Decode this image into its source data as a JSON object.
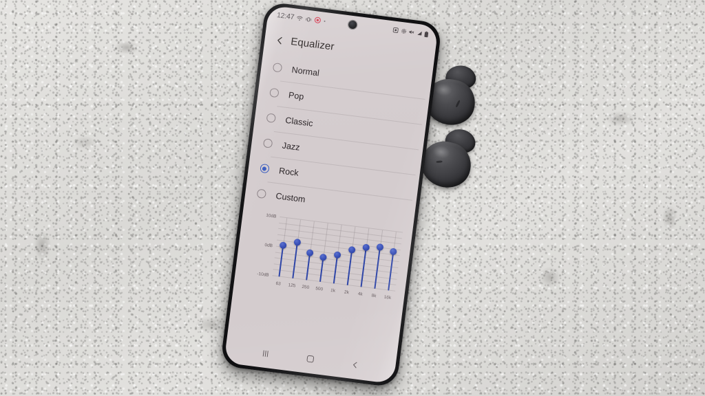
{
  "scene": {
    "background": "textured white concrete wall",
    "device": "smartphone lying on wall, rotated slightly clockwise",
    "accessory": "two dark grey wireless earbuds"
  },
  "statusbar": {
    "clock": "12:47",
    "left_icons": [
      "wifi-icon",
      "vibrate-icon",
      "record-icon",
      "dot-icon"
    ],
    "right_icons": [
      "screenshot-icon",
      "settings-icon",
      "mute-icon",
      "signal-icon",
      "battery-icon"
    ]
  },
  "appbar": {
    "back_label": "back-chevron",
    "title": "Equalizer"
  },
  "presets": {
    "selected": "Rock",
    "items": [
      {
        "label": "Normal",
        "selected": false
      },
      {
        "label": "Pop",
        "selected": false
      },
      {
        "label": "Classic",
        "selected": false
      },
      {
        "label": "Jazz",
        "selected": false
      },
      {
        "label": "Rock",
        "selected": true
      },
      {
        "label": "Custom",
        "selected": false
      }
    ]
  },
  "chart_data": {
    "type": "bar",
    "title": "Equalizer",
    "xlabel": "",
    "ylabel": "dB",
    "categories": [
      "63",
      "125",
      "250",
      "500",
      "1k",
      "2k",
      "4k",
      "8k",
      "16k"
    ],
    "values": [
      0.6,
      2.4,
      -0.8,
      -1.6,
      -0.2,
      2.2,
      3.6,
      4.2,
      3.2
    ],
    "ylim": [
      -10,
      10
    ],
    "ytick_labels": [
      "10dB",
      "0dB",
      "-10dB"
    ],
    "yticks": [
      10,
      0,
      -10
    ],
    "grid": true,
    "legend": "none",
    "accent_color": "#3c5ec0"
  },
  "navbar": {
    "recents_label": "recents-button",
    "home_label": "home-button",
    "back_label": "back-button"
  },
  "colors": {
    "accent": "#3c5ec0",
    "screen_bg": "#d4ccce",
    "text": "#2b2528",
    "muted_text": "#6a6064",
    "frame": "#151517"
  }
}
